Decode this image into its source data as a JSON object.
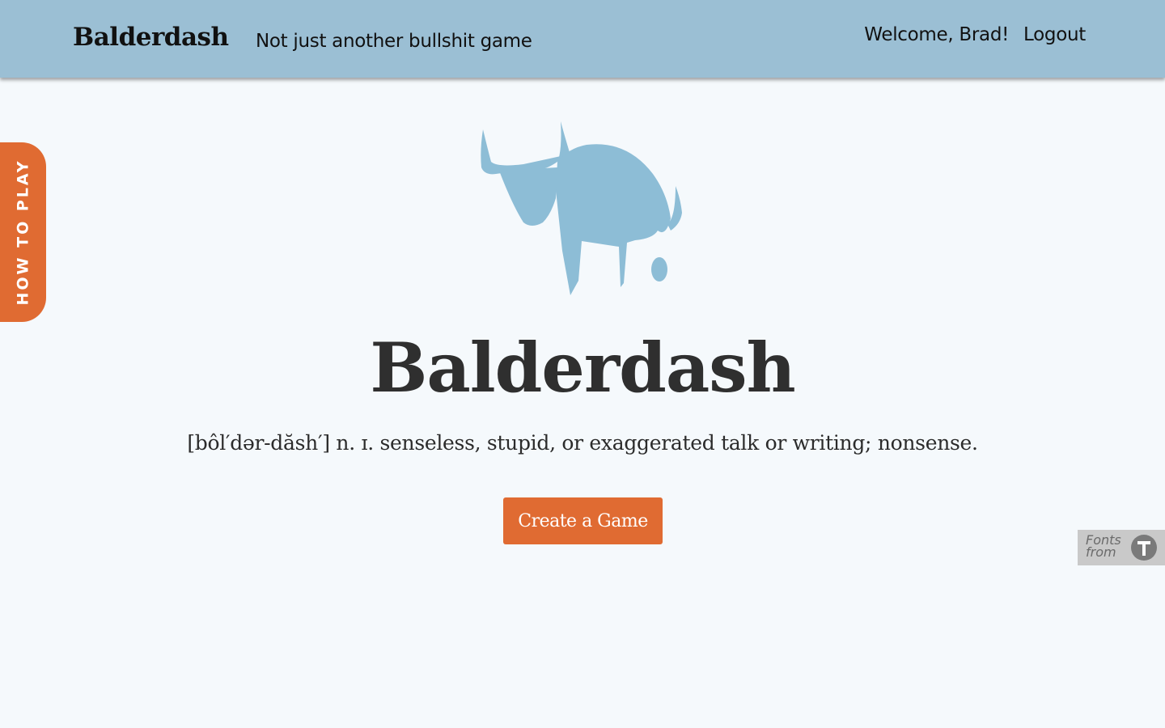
{
  "header": {
    "brand": "Balderdash",
    "tagline": "Not just another bullshit game",
    "welcome": "Welcome, Brad!",
    "logout_label": "Logout",
    "background_color": "#9bbfd4"
  },
  "side_tab": {
    "label": "HOW TO PLAY",
    "color": "#e06b32"
  },
  "hero": {
    "logo_icon": "bull-icon",
    "logo_color": "#8dbdd6",
    "title": "Balderdash",
    "definition": "[bôl′dər-dăsh′] n. ɪ. senseless, stupid, or exaggerated talk or writing; nonsense.",
    "cta_label": "Create a Game",
    "cta_color": "#e06b32"
  },
  "fonts_badge": {
    "text_line1": "Fonts",
    "text_line2": "from",
    "icon": "typekit-icon"
  }
}
